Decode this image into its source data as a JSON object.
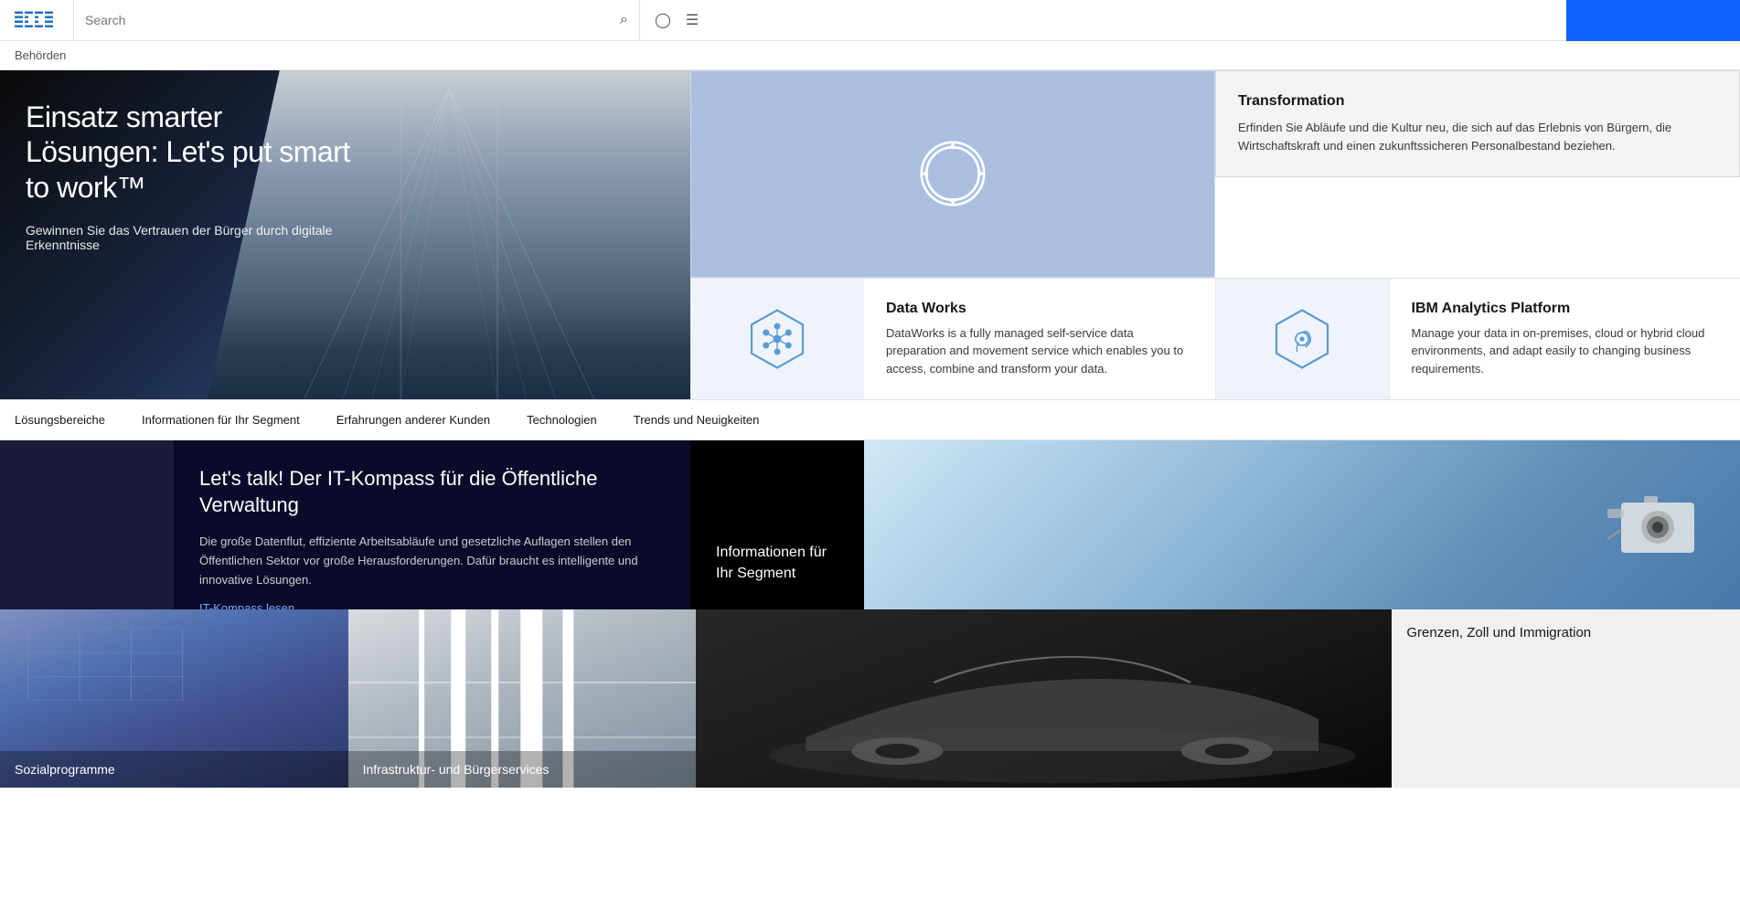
{
  "header": {
    "logo_alt": "IBM",
    "search_placeholder": "Search",
    "blue_bar_label": ""
  },
  "breadcrumb": {
    "text": "Behörden"
  },
  "hero": {
    "title": "Einsatz smarter Lösungen: Let's put smart to work™",
    "subtitle": "Gewinnen Sie das Vertrauen der Bürger durch digitale Erkenntnisse",
    "transformation_title": "Transformation",
    "transformation_desc": "Erfinden Sie Abläufe und die Kultur neu, die sich auf das Erlebnis von Bürgern, die Wirtschaftskraft und einen zukunftssicheren Personal­bestand beziehen."
  },
  "data_works": {
    "title": "Data Works",
    "desc": "DataWorks is a fully managed self-service data preparation and movement service which enables you to access, combine and transform your data."
  },
  "analytics": {
    "title": "IBM Analytics Platform",
    "desc": "Manage your data in on-premises, cloud or hybrid cloud environments, and adapt easily to changing business requirements."
  },
  "nav": {
    "items": [
      "Lösungsbereiche",
      "Informationen für Ihr Segment",
      "Erfahrungen anderer Kunden",
      "Technologien",
      "Trends und Neuigkeiten"
    ]
  },
  "content": {
    "it_kompass_title": "Let's talk! Der IT-Kompass für die Öffentliche Verwaltung",
    "it_kompass_desc": "Die große Datenflut, effiziente Arbeitsabläufe und gesetzliche Auflagen stellen den Öffentlichen Sektor vor große Herausforderungen. Dafür braucht es intelligente und innovative Lösungen.",
    "it_kompass_link": "IT-Kompass lesen",
    "segment_title": "Informationen für Ihr Segment"
  },
  "bottom": {
    "sozial_label": "Sozialprogramme",
    "infra_label": "Infrastruktur- und Bürgerservices",
    "grenzen_label": "Grenzen, Zoll und Immigration"
  },
  "icons": {
    "search": "🔍",
    "user": "👤",
    "menu": "☰",
    "camera": "📷"
  }
}
